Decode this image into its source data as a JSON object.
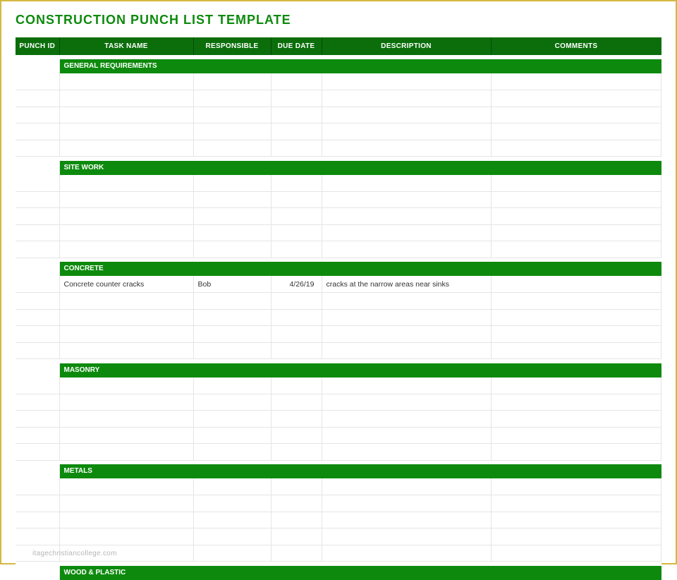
{
  "title": "CONSTRUCTION PUNCH LIST TEMPLATE",
  "headers": {
    "punch_id": "PUNCH ID",
    "task_name": "TASK NAME",
    "responsible": "RESPONSIBLE",
    "due_date": "DUE DATE",
    "description": "DESCRIPTION",
    "comments": "COMMENTS"
  },
  "sections": [
    {
      "name": "GENERAL REQUIREMENTS",
      "rows": [
        {
          "punch_id": "",
          "task_name": "",
          "responsible": "",
          "due_date": "",
          "description": "",
          "comments": ""
        },
        {
          "punch_id": "",
          "task_name": "",
          "responsible": "",
          "due_date": "",
          "description": "",
          "comments": ""
        },
        {
          "punch_id": "",
          "task_name": "",
          "responsible": "",
          "due_date": "",
          "description": "",
          "comments": ""
        },
        {
          "punch_id": "",
          "task_name": "",
          "responsible": "",
          "due_date": "",
          "description": "",
          "comments": ""
        },
        {
          "punch_id": "",
          "task_name": "",
          "responsible": "",
          "due_date": "",
          "description": "",
          "comments": ""
        }
      ]
    },
    {
      "name": "SITE WORK",
      "rows": [
        {
          "punch_id": "",
          "task_name": "",
          "responsible": "",
          "due_date": "",
          "description": "",
          "comments": ""
        },
        {
          "punch_id": "",
          "task_name": "",
          "responsible": "",
          "due_date": "",
          "description": "",
          "comments": ""
        },
        {
          "punch_id": "",
          "task_name": "",
          "responsible": "",
          "due_date": "",
          "description": "",
          "comments": ""
        },
        {
          "punch_id": "",
          "task_name": "",
          "responsible": "",
          "due_date": "",
          "description": "",
          "comments": ""
        },
        {
          "punch_id": "",
          "task_name": "",
          "responsible": "",
          "due_date": "",
          "description": "",
          "comments": ""
        }
      ]
    },
    {
      "name": "CONCRETE",
      "rows": [
        {
          "punch_id": "",
          "task_name": "Concrete counter cracks",
          "responsible": "Bob",
          "due_date": "4/26/19",
          "description": "cracks at the narrow areas near sinks",
          "comments": ""
        },
        {
          "punch_id": "",
          "task_name": "",
          "responsible": "",
          "due_date": "",
          "description": "",
          "comments": ""
        },
        {
          "punch_id": "",
          "task_name": "",
          "responsible": "",
          "due_date": "",
          "description": "",
          "comments": ""
        },
        {
          "punch_id": "",
          "task_name": "",
          "responsible": "",
          "due_date": "",
          "description": "",
          "comments": ""
        },
        {
          "punch_id": "",
          "task_name": "",
          "responsible": "",
          "due_date": "",
          "description": "",
          "comments": ""
        }
      ]
    },
    {
      "name": "MASONRY",
      "rows": [
        {
          "punch_id": "",
          "task_name": "",
          "responsible": "",
          "due_date": "",
          "description": "",
          "comments": ""
        },
        {
          "punch_id": "",
          "task_name": "",
          "responsible": "",
          "due_date": "",
          "description": "",
          "comments": ""
        },
        {
          "punch_id": "",
          "task_name": "",
          "responsible": "",
          "due_date": "",
          "description": "",
          "comments": ""
        },
        {
          "punch_id": "",
          "task_name": "",
          "responsible": "",
          "due_date": "",
          "description": "",
          "comments": ""
        },
        {
          "punch_id": "",
          "task_name": "",
          "responsible": "",
          "due_date": "",
          "description": "",
          "comments": ""
        }
      ]
    },
    {
      "name": "METALS",
      "rows": [
        {
          "punch_id": "",
          "task_name": "",
          "responsible": "",
          "due_date": "",
          "description": "",
          "comments": ""
        },
        {
          "punch_id": "",
          "task_name": "",
          "responsible": "",
          "due_date": "",
          "description": "",
          "comments": ""
        },
        {
          "punch_id": "",
          "task_name": "",
          "responsible": "",
          "due_date": "",
          "description": "",
          "comments": ""
        },
        {
          "punch_id": "",
          "task_name": "",
          "responsible": "",
          "due_date": "",
          "description": "",
          "comments": ""
        },
        {
          "punch_id": "",
          "task_name": "",
          "responsible": "",
          "due_date": "",
          "description": "",
          "comments": ""
        }
      ]
    },
    {
      "name": "WOOD & PLASTIC",
      "rows": []
    }
  ],
  "watermark": "itagechristiancollege.com"
}
